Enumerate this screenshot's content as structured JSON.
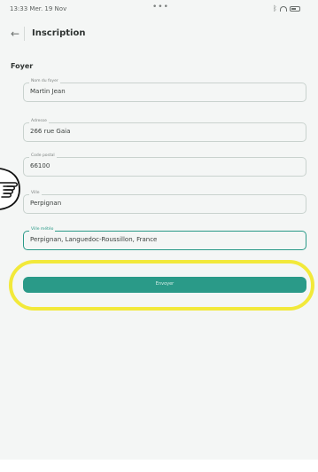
{
  "status_bar": {
    "time": "13:33 Mer. 19 Nov",
    "dots": "•••",
    "bluetooth_icon": "bluetooth-icon",
    "wifi_icon": "wifi-icon",
    "battery_icon": "battery-icon"
  },
  "header": {
    "back_icon": "arrow-left-icon",
    "back_glyph": "←",
    "title": "Inscription"
  },
  "section": {
    "title": "Foyer"
  },
  "form": {
    "fields": [
      {
        "label": "Nom du foyer",
        "value": "Martin Jean"
      },
      {
        "label": "Adresse",
        "value": "266 rue Gaia"
      },
      {
        "label": "Code postal",
        "value": "66100"
      },
      {
        "label": "Ville",
        "value": "Perpignan"
      },
      {
        "label": "Ville météo",
        "value": "Perpignan, Languedoc-Roussillon, France"
      }
    ],
    "submit_label": "Envoyer"
  },
  "annotations": {
    "pointer_icon": "hand-pointer-icon",
    "highlight_color": "#f2e93a"
  },
  "colors": {
    "accent": "#2a9a88"
  }
}
